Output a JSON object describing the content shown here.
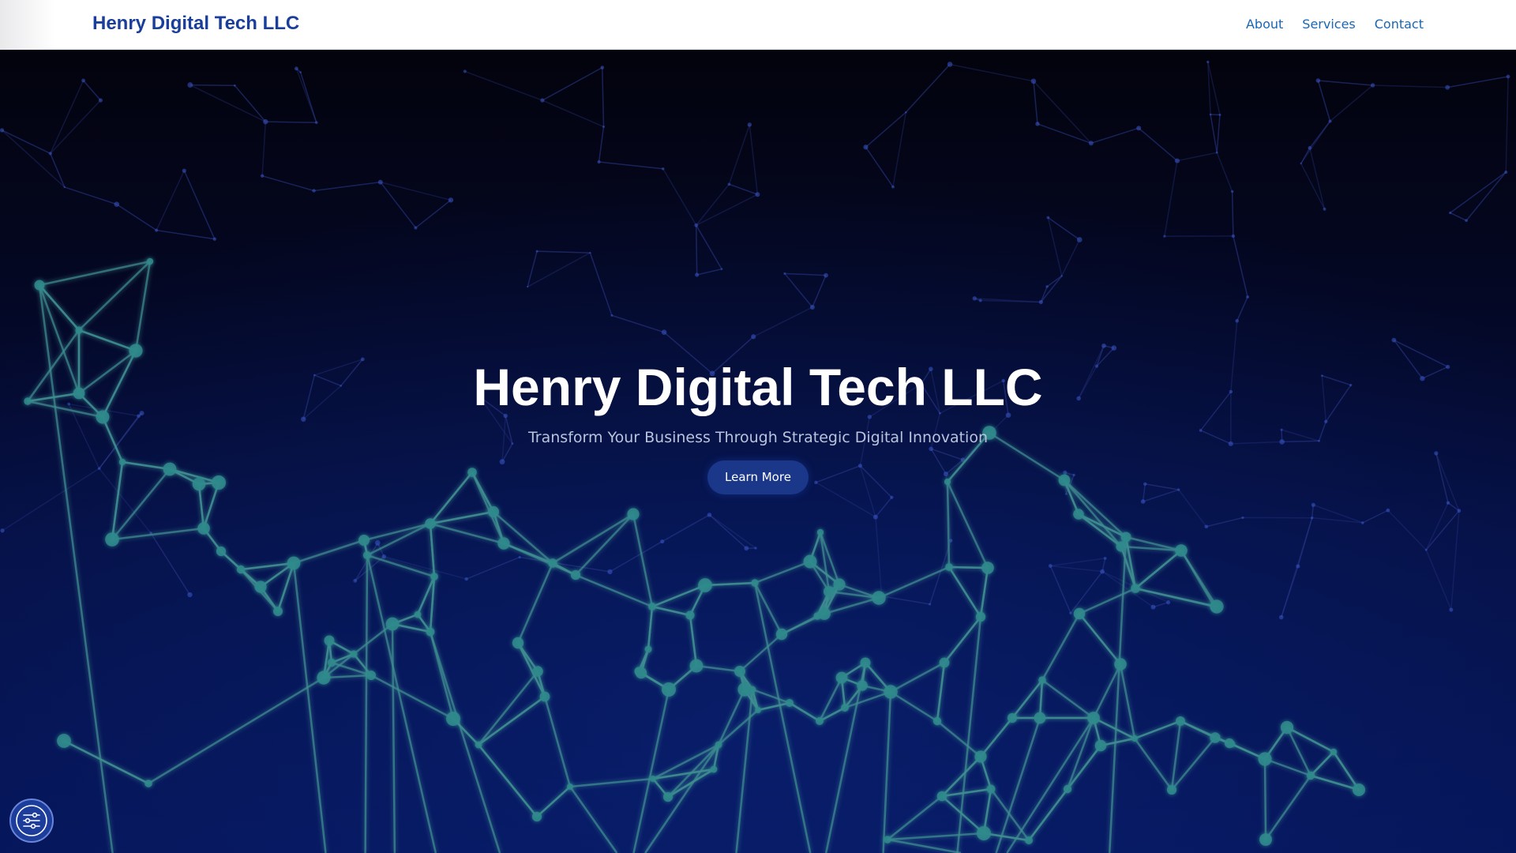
{
  "header": {
    "brand": "Henry Digital Tech LLC",
    "nav": [
      {
        "label": "About"
      },
      {
        "label": "Services"
      },
      {
        "label": "Contact"
      }
    ]
  },
  "hero": {
    "title": "Henry Digital Tech LLC",
    "subtitle": "Transform Your Business Through Strategic Digital Innovation",
    "cta_label": "Learn More"
  },
  "floating_button": {
    "icon": "sliders-icon"
  },
  "colors": {
    "brand": "#1a3e9b",
    "nav_link": "#1a66b3",
    "hero_bg_top": "#03030d",
    "hero_bg_bottom": "#061456",
    "network_line": "#3f8f92",
    "network_node": "#2f7f8a",
    "button": "#1a3789"
  }
}
